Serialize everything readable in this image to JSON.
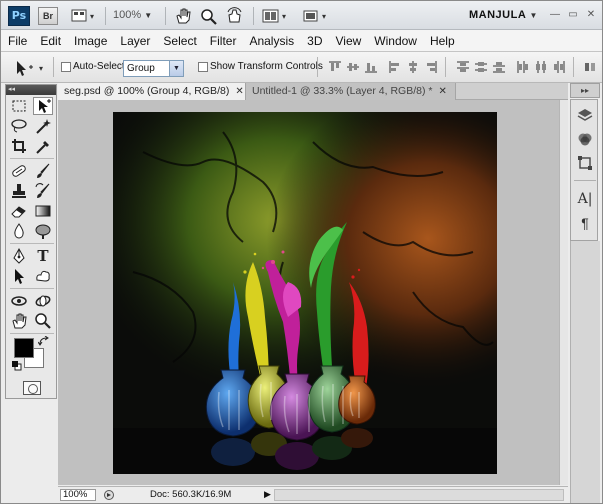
{
  "appbar": {
    "ps_logo": "Ps",
    "br_logo": "Br",
    "zoom": "100%",
    "workspace": "MANJULA"
  },
  "menu": [
    "File",
    "Edit",
    "Image",
    "Layer",
    "Select",
    "Filter",
    "Analysis",
    "3D",
    "View",
    "Window",
    "Help"
  ],
  "options": {
    "auto_select_label": "Auto-Select:",
    "auto_select_value": "Group",
    "show_transform_label": "Show Transform Controls"
  },
  "tabs": [
    {
      "label": "seg.psd @ 100% (Group 4, RGB/8)",
      "active": true
    },
    {
      "label": "Untitled-1 @ 33.3% (Layer 4, RGB/8) *",
      "active": false
    }
  ],
  "status": {
    "zoom": "100%",
    "doc_info": "Doc: 560.3K/16.9M"
  },
  "colors": {
    "foreground": "#000000",
    "background": "#ffffff",
    "accent": "#0d3c67"
  },
  "icons": {
    "tools": [
      "marquee-icon",
      "move-icon",
      "lasso-icon",
      "magic-wand-icon",
      "crop-icon",
      "eyedropper-icon",
      "healing-brush-icon",
      "brush-icon",
      "clone-stamp-icon",
      "history-brush-icon",
      "eraser-icon",
      "gradient-icon",
      "blur-icon",
      "dodge-icon",
      "pen-icon",
      "type-icon",
      "path-selection-icon",
      "custom-shape-icon",
      "3d-rotate-icon",
      "3d-orbit-icon",
      "hand-icon",
      "zoom-icon"
    ],
    "dock": [
      "layers-icon",
      "channels-icon",
      "transform-icon",
      "character-icon",
      "paragraph-icon"
    ]
  }
}
